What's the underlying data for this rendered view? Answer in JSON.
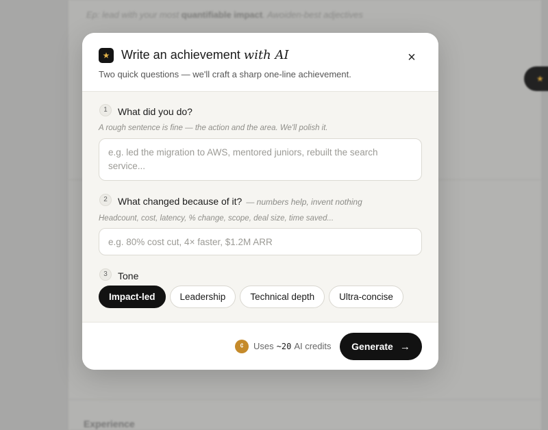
{
  "background": {
    "hint_prefix": "Ep: lead with your most",
    "hint_bold": "quantifiable impact",
    "hint_suffix": ". Awoiden-best adjectives",
    "section_label": "Experience"
  },
  "modal": {
    "title_main": "Write an achievement",
    "title_italic": "with AI",
    "subtitle": "Two quick questions — we'll craft a sharp one-line achievement.",
    "close_icon": "×",
    "logo_icon": "★"
  },
  "questions": [
    {
      "number": "1",
      "label": "What did you do?",
      "note": "",
      "hint": "A rough sentence is fine — the action and the area. We'll polish it.",
      "value": "",
      "placeholder": "e.g. led the migration to AWS, mentored juniors, rebuilt the search service..."
    },
    {
      "number": "2",
      "label": "What changed because of it?",
      "note": "— numbers help, invent nothing",
      "hint": "Headcount, cost, latency, % change, scope, deal size, time saved...",
      "value": "",
      "placeholder": "e.g. 80% cost cut, 4× faster, $1.2M ARR"
    },
    {
      "number": "3",
      "label": "Tone",
      "options": [
        "Impact-led",
        "Leadership",
        "Technical depth",
        "Ultra-concise"
      ],
      "selected": "Impact-led"
    }
  ],
  "footer": {
    "coin_icon": "¢",
    "uses_label": "Uses",
    "credit_amount": "~20",
    "credits_label": "AI credits",
    "generate_label": "Generate",
    "generate_icon": "→"
  },
  "colors": {
    "accent": "#121212",
    "coin": "#c58a2a",
    "logo_star": "#e4b44a"
  }
}
